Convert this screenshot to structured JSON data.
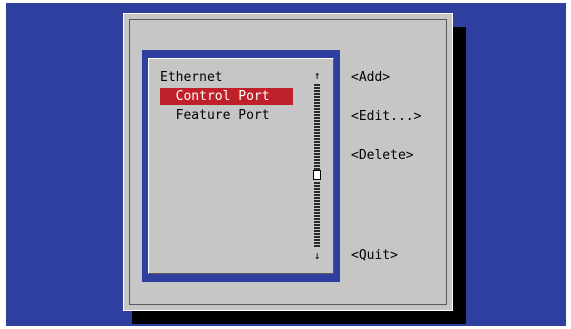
{
  "list": {
    "items": [
      {
        "label": "Ethernet",
        "selected": false
      },
      {
        "label": "  Control Port",
        "selected": true
      },
      {
        "label": "  Feature Port",
        "selected": false
      }
    ]
  },
  "scrollbar": {
    "up_glyph": "↑",
    "down_glyph": "↓",
    "up_icon": "arrow-up-icon",
    "down_icon": "arrow-down-icon"
  },
  "buttons": {
    "add": "<Add>",
    "edit": "<Edit...>",
    "delete": "<Delete>",
    "quit": "<Quit>"
  },
  "colors": {
    "screen_background": "#2e3fa0",
    "dialog_background": "#c6c6c6",
    "selection_background": "#c0202a",
    "selection_text": "#ffffff"
  }
}
